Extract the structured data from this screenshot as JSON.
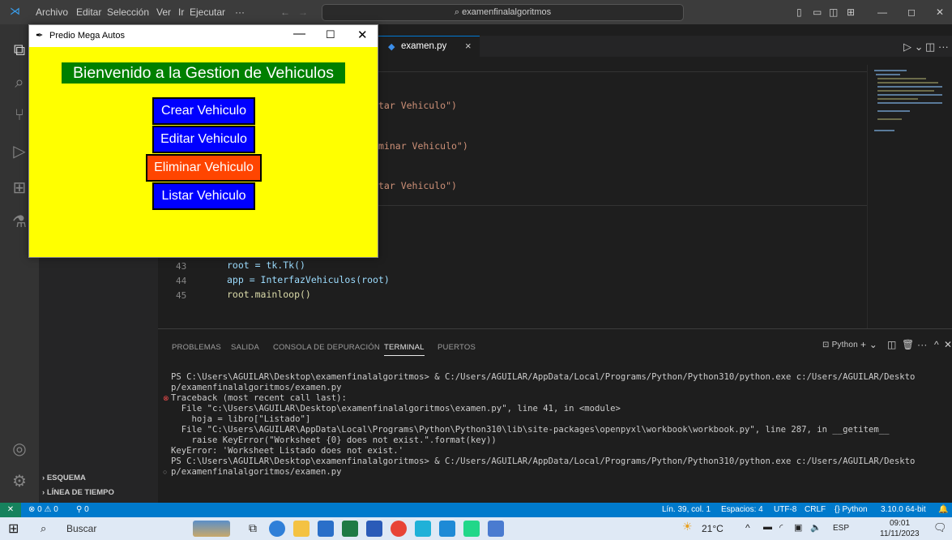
{
  "vscode": {
    "menu": [
      "Archivo",
      "Editar",
      "Selección",
      "Ver",
      "Ir",
      "Ejecutar",
      "···"
    ],
    "search_text": "examenfinalalgoritmos",
    "tab": {
      "label": "examen.py",
      "close": "×"
    },
    "code_fragments": [
      "tar Vehiculo\")",
      "minar Vehiculo\")",
      "tar Vehiculo\")"
    ],
    "code_lines": [
      {
        "num": "43",
        "text": "root = tk.Tk()"
      },
      {
        "num": "44",
        "text": "app = InterfazVehiculos(root)"
      },
      {
        "num": "45",
        "text": "root.mainloop()"
      }
    ],
    "sidebar": {
      "outline": "ESQUEMA",
      "timeline": "LÍNEA DE TIEMPO"
    }
  },
  "panel": {
    "tabs": [
      "PROBLEMAS",
      "SALIDA",
      "CONSOLA DE DEPURACIÓN",
      "TERMINAL",
      "PUERTOS"
    ],
    "active_tab": "TERMINAL",
    "shell_label": "Python",
    "terminal_lines": [
      "PS C:\\Users\\AGUILAR\\Desktop\\examenfinalalgoritmos> & C:/Users/AGUILAR/AppData/Local/Programs/Python/Python310/python.exe c:/Users/AGUILAR/Deskto",
      "p/examenfinalalgoritmos/examen.py",
      "Traceback (most recent call last):",
      "  File \"c:\\Users\\AGUILAR\\Desktop\\examenfinalalgoritmos\\examen.py\", line 41, in <module>",
      "    hoja = libro[\"Listado\"]",
      "  File \"C:\\Users\\AGUILAR\\AppData\\Local\\Programs\\Python\\Python310\\lib\\site-packages\\openpyxl\\workbook\\workbook.py\", line 287, in __getitem__",
      "    raise KeyError(\"Worksheet {0} does not exist.\".format(key))",
      "KeyError: 'Worksheet Listado does not exist.'",
      "PS C:\\Users\\AGUILAR\\Desktop\\examenfinalalgoritmos> & C:/Users/AGUILAR/AppData/Local/Programs/Python/Python310/python.exe c:/Users/AGUILAR/Deskto",
      "p/examenfinalalgoritmos/examen.py"
    ]
  },
  "statusbar": {
    "problems": "⊗ 0 ⚠ 0",
    "ports": "⚲ 0",
    "position": "Lín. 39, col. 1",
    "spaces": "Espacios: 4",
    "encoding": "UTF-8",
    "eol": "CRLF",
    "language": "{} Python",
    "interpreter": "3.10.0 64-bit"
  },
  "taskbar": {
    "search_placeholder": "Buscar",
    "weather": "21°C",
    "language": "ESP",
    "time": "09:01",
    "date": "11/11/2023"
  },
  "tk": {
    "window_title": "Predio Mega Autos",
    "heading": "Bienvenido a la Gestion de Vehiculos",
    "buttons": [
      "Crear Vehiculo",
      "Editar Vehiculo",
      "Eliminar Vehiculo",
      "Listar Vehiculo"
    ],
    "colors": {
      "background": "#ffff00",
      "heading_bg": "#008000",
      "button_blue": "#0000ff",
      "button_red": "#ff4500"
    }
  }
}
